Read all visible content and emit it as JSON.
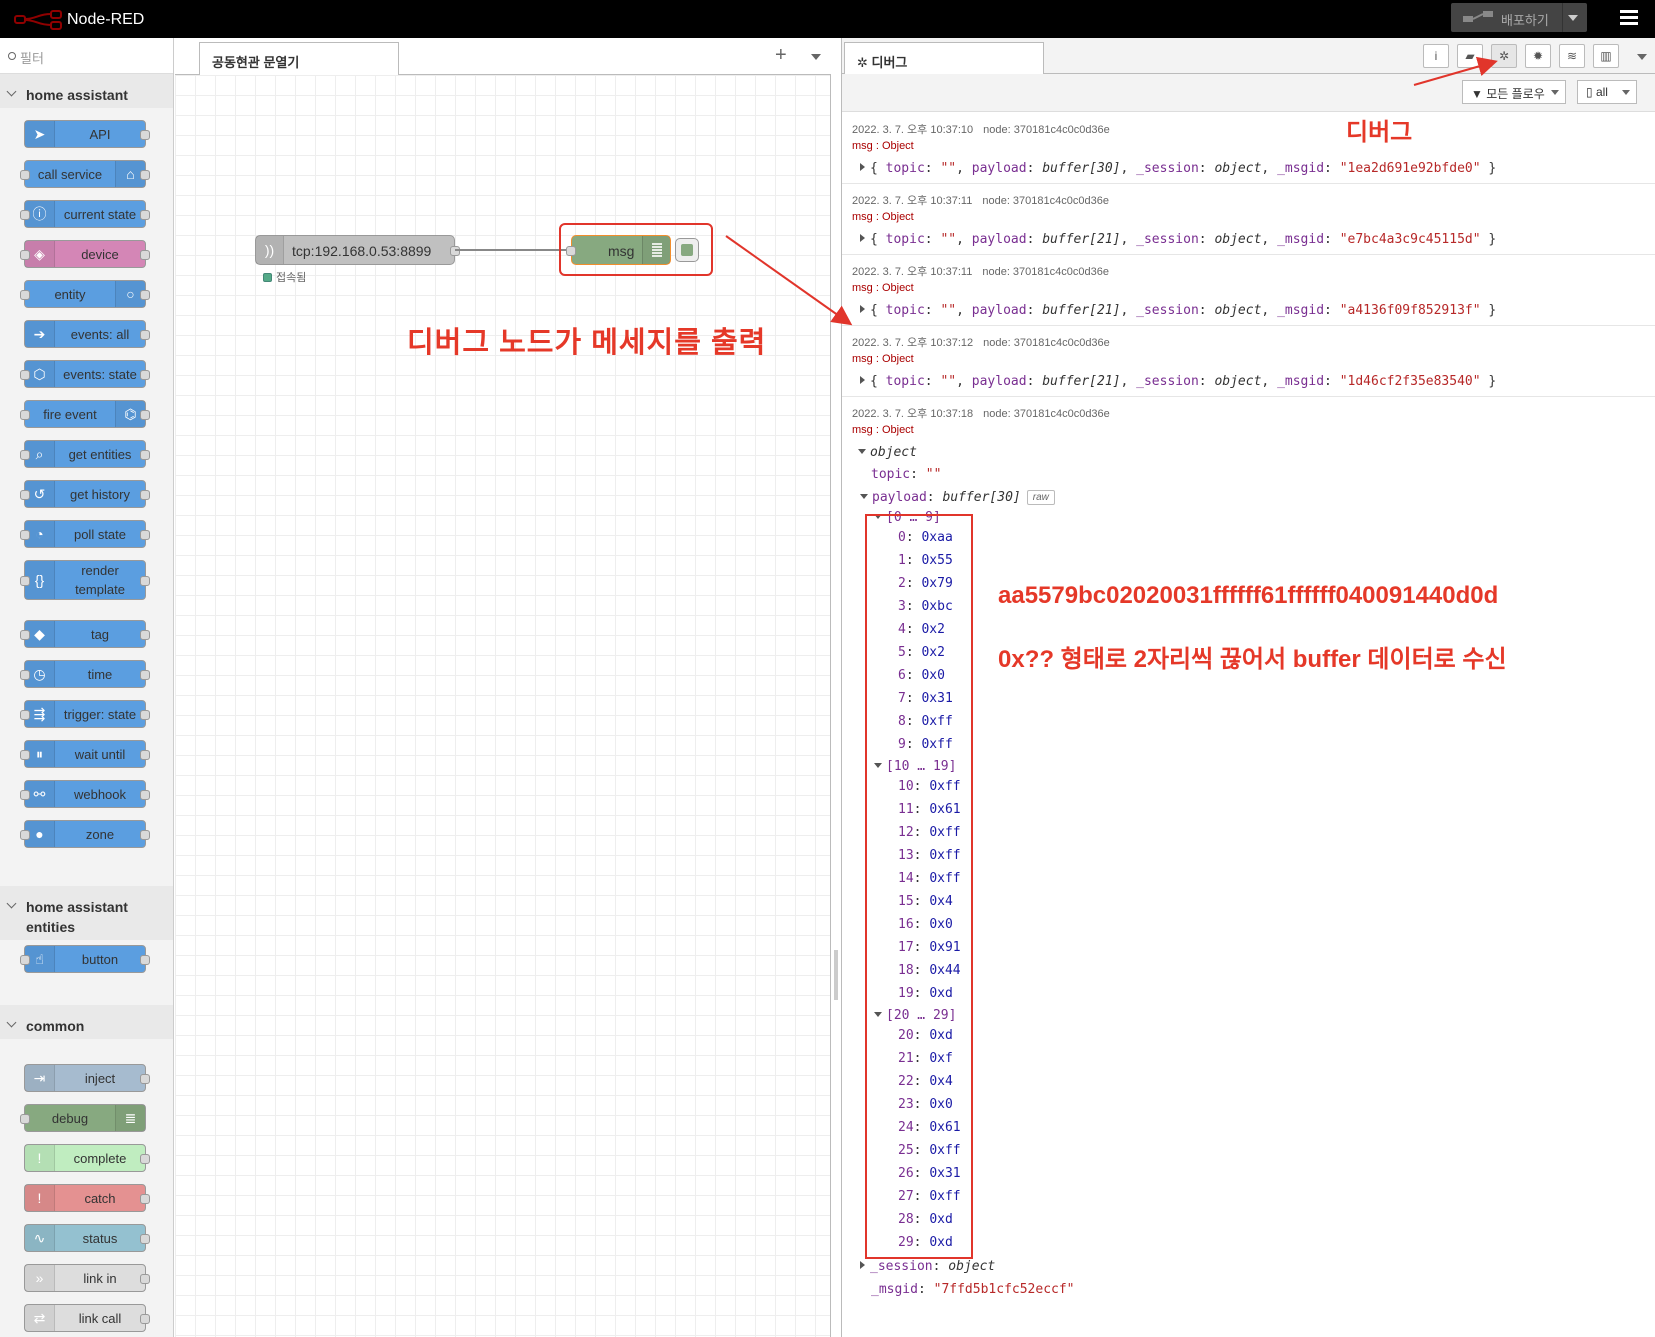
{
  "app": {
    "title": "Node-RED",
    "deploy_label": "배포하기"
  },
  "palette": {
    "filter_placeholder": "필터",
    "categories": [
      {
        "name": "home assistant"
      },
      {
        "name": "home assistant entities"
      },
      {
        "name": "common"
      }
    ],
    "nodes": [
      {
        "label": "API",
        "color": "#5b9ee0",
        "icon": "paper-plane-icon"
      },
      {
        "label": "call service",
        "color": "#5b9ee0",
        "icon": "router-icon"
      },
      {
        "label": "current state",
        "color": "#5b9ee0",
        "icon": "info-circle-icon"
      },
      {
        "label": "device",
        "color": "#d486b6",
        "icon": "cube-icon"
      },
      {
        "label": "entity",
        "color": "#5b9ee0",
        "icon": "circle-icon"
      },
      {
        "label": "events: all",
        "color": "#5b9ee0",
        "icon": "arrow-right-icon"
      },
      {
        "label": "events: state",
        "color": "#5b9ee0",
        "icon": "hexagon-arrow-icon"
      },
      {
        "label": "fire event",
        "color": "#5b9ee0",
        "icon": "broadcast-icon"
      },
      {
        "label": "get entities",
        "color": "#5b9ee0",
        "icon": "search-doc-icon"
      },
      {
        "label": "get history",
        "color": "#5b9ee0",
        "icon": "history-icon"
      },
      {
        "label": "poll state",
        "color": "#5b9ee0",
        "icon": "timer-icon"
      },
      {
        "label": "render template",
        "color": "#5b9ee0",
        "icon": "braces-icon"
      },
      {
        "label": "tag",
        "color": "#5b9ee0",
        "icon": "tag-icon"
      },
      {
        "label": "time",
        "color": "#5b9ee0",
        "icon": "clock-icon"
      },
      {
        "label": "trigger: state",
        "color": "#5b9ee0",
        "icon": "sign-icon"
      },
      {
        "label": "wait until",
        "color": "#5b9ee0",
        "icon": "pause-icon"
      },
      {
        "label": "webhook",
        "color": "#5b9ee0",
        "icon": "webhook-icon"
      },
      {
        "label": "zone",
        "color": "#5b9ee0",
        "icon": "map-pin-icon"
      },
      {
        "label": "button",
        "color": "#5b9ee0",
        "icon": "hand-pointer-icon"
      },
      {
        "label": "inject",
        "color": "#a6bbcf",
        "icon": "inject-arrow-icon"
      },
      {
        "label": "debug",
        "color": "#87a980",
        "icon": "list-icon"
      },
      {
        "label": "complete",
        "color": "#c0edc0",
        "icon": "exclamation-icon"
      },
      {
        "label": "catch",
        "color": "#e49191",
        "icon": "exclamation-icon"
      },
      {
        "label": "status",
        "color": "#94c1d0",
        "icon": "pulse-icon"
      },
      {
        "label": "link in",
        "color": "#dddddd",
        "icon": "link-in-icon"
      },
      {
        "label": "link call",
        "color": "#dddddd",
        "icon": "link-call-icon"
      }
    ]
  },
  "workspace": {
    "tab_label": "공동현관 문열기",
    "tcp_node": {
      "label": "tcp:192.168.0.53:8899",
      "status": "접속됨"
    },
    "debug_node": {
      "label": "msg"
    },
    "annotation": "디버그 노드가 메세지를 출력"
  },
  "sidebar": {
    "tab_label": "디버그",
    "annotation": "디버그",
    "filter_flows": "모든 플로우",
    "filter_all": "all",
    "messages": [
      {
        "time": "2022. 3. 7. 오후 10:37:10",
        "node": "node: 370181c4c0c0d36e",
        "type": "msg : Object",
        "buf": "buffer[30]",
        "msgid": "\"1ea2d691e92bfde0\""
      },
      {
        "time": "2022. 3. 7. 오후 10:37:11",
        "node": "node: 370181c4c0c0d36e",
        "type": "msg : Object",
        "buf": "buffer[21]",
        "msgid": "\"e7bc4a3c9c45115d\""
      },
      {
        "time": "2022. 3. 7. 오후 10:37:11",
        "node": "node: 370181c4c0c0d36e",
        "type": "msg : Object",
        "buf": "buffer[21]",
        "msgid": "\"a4136f09f852913f\""
      },
      {
        "time": "2022. 3. 7. 오후 10:37:12",
        "node": "node: 370181c4c0c0d36e",
        "type": "msg : Object",
        "buf": "buffer[21]",
        "msgid": "\"1d46cf2f35e83540\""
      }
    ],
    "expanded": {
      "time": "2022. 3. 7. 오후 10:37:18",
      "node": "node: 370181c4c0c0d36e",
      "type": "msg : Object",
      "object_label": "object",
      "topic_value": "\"\"",
      "payload_type": "buffer[30]",
      "raw_label": "raw",
      "groups": [
        "[0 … 9]",
        "[10 … 19]",
        "[20 … 29]"
      ],
      "bytes": [
        "0xaa",
        "0x55",
        "0x79",
        "0xbc",
        "0x2",
        "0x2",
        "0x0",
        "0x31",
        "0xff",
        "0xff",
        "0xff",
        "0x61",
        "0xff",
        "0xff",
        "0xff",
        "0x4",
        "0x0",
        "0x91",
        "0x44",
        "0xd",
        "0xd",
        "0xf",
        "0x4",
        "0x0",
        "0x61",
        "0xff",
        "0x31",
        "0xff",
        "0xd",
        "0xd"
      ],
      "session_type": "object",
      "msgid": "\"7ffd5b1cfc52eccf\""
    },
    "annotation_hex": "aa5579bc02020031ffffff61ffffff040091440d0d",
    "annotation_explain": "0x?? 형태로 2자리씩 끊어서 buffer 데이터로 수신"
  },
  "colors": {
    "annotation": "#e53828",
    "debug_node": "#87a980",
    "ha_blue": "#5b9ee0"
  }
}
